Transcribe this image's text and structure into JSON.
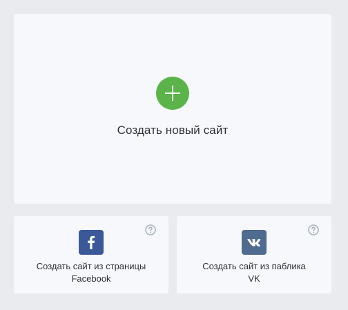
{
  "create_new": {
    "label": "Создать новый сайт",
    "accent_color": "#5bb44a",
    "icon": "plus-icon"
  },
  "from_facebook": {
    "line1": "Создать сайт из страницы",
    "line2": "Facebook",
    "icon": "facebook-icon",
    "brand_color": "#3b5998",
    "help_icon": "question-circle-icon"
  },
  "from_vk": {
    "line1": "Создать сайт из паблика",
    "line2": "VK",
    "icon": "vk-icon",
    "brand_color": "#4f6b8f",
    "help_icon": "question-circle-icon"
  }
}
